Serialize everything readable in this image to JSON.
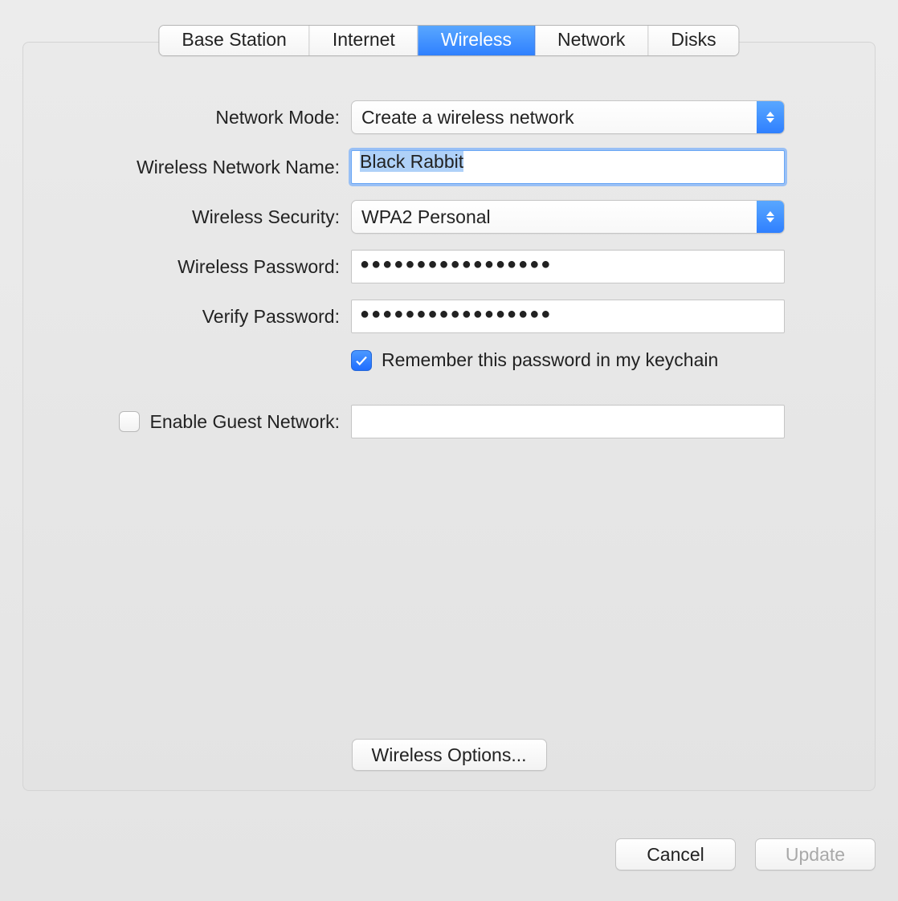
{
  "tabs": {
    "base_station": "Base Station",
    "internet": "Internet",
    "wireless": "Wireless",
    "network": "Network",
    "disks": "Disks",
    "active": "wireless"
  },
  "labels": {
    "network_mode": "Network Mode:",
    "network_name": "Wireless Network Name:",
    "security": "Wireless Security:",
    "password": "Wireless Password:",
    "verify": "Verify Password:",
    "remember": "Remember this password in my keychain",
    "guest": "Enable Guest Network:"
  },
  "values": {
    "network_mode": "Create a wireless network",
    "network_name": "Black Rabbit",
    "security": "WPA2 Personal",
    "password_mask": "●●●●●●●●●●●●●●●●●",
    "verify_mask": "●●●●●●●●●●●●●●●●●",
    "remember_checked": true,
    "guest_checked": false,
    "guest_name": ""
  },
  "buttons": {
    "options": "Wireless Options...",
    "cancel": "Cancel",
    "update": "Update"
  }
}
